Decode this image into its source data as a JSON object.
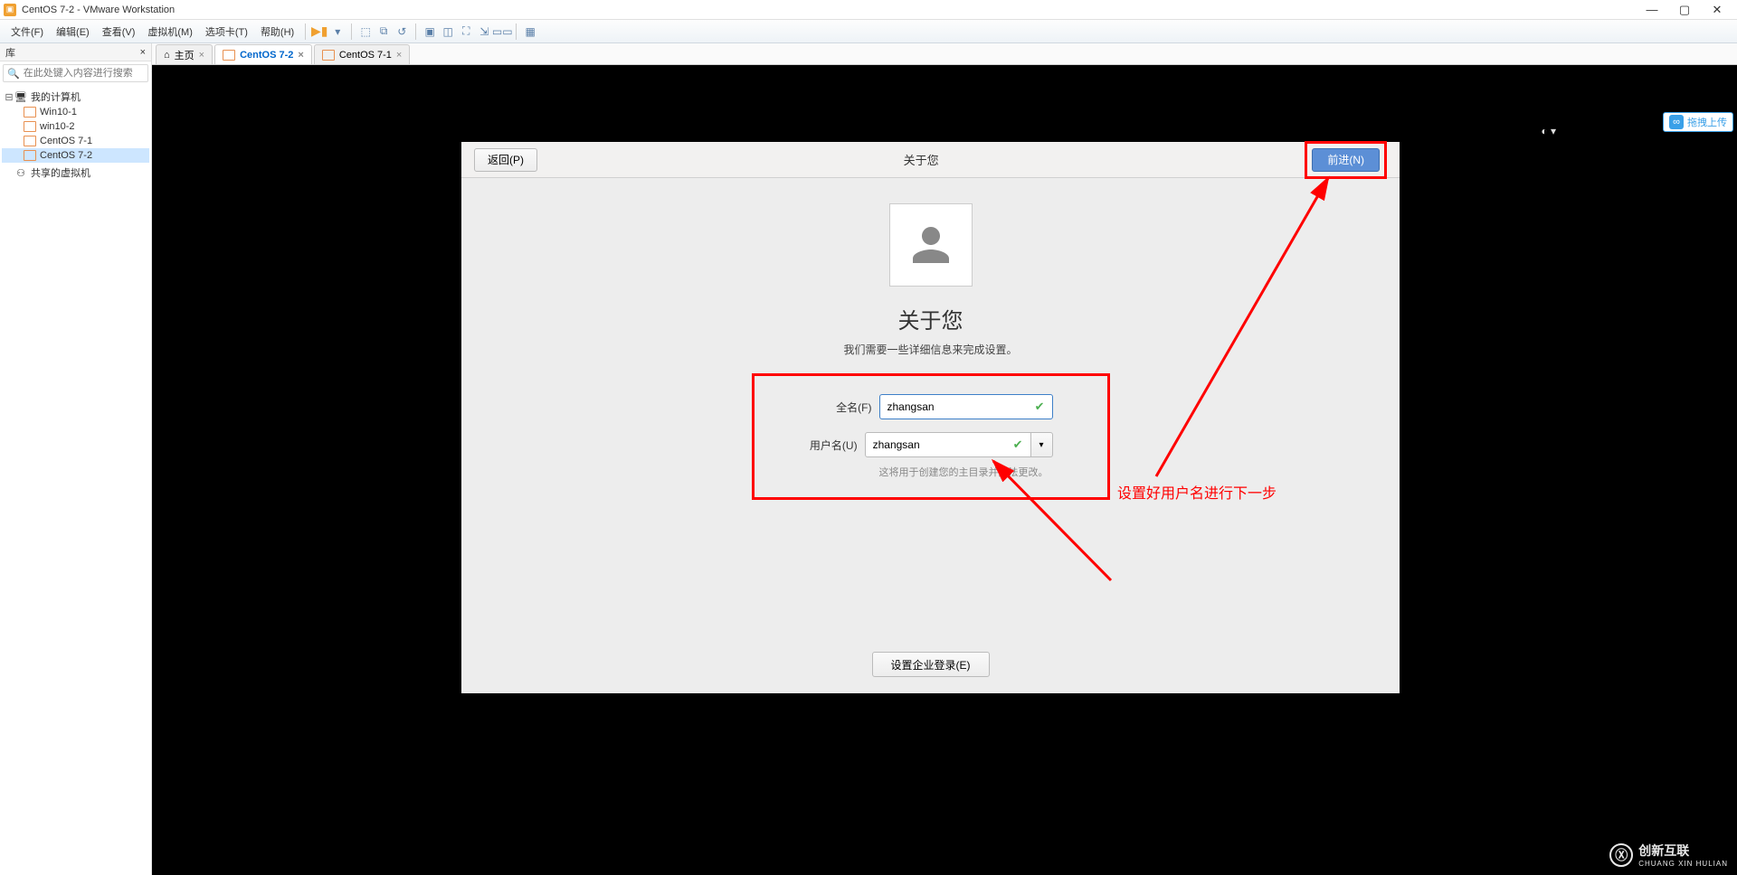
{
  "titlebar": {
    "text": "CentOS 7-2 - VMware Workstation"
  },
  "menu": {
    "file": "文件(F)",
    "edit": "编辑(E)",
    "view": "查看(V)",
    "vm": "虚拟机(M)",
    "tabs": "选项卡(T)",
    "help": "帮助(H)"
  },
  "sidebar": {
    "title": "库",
    "search_placeholder": "在此处键入内容进行搜索",
    "root": "我的计算机",
    "items": [
      {
        "label": "Win10-1"
      },
      {
        "label": "win10-2"
      },
      {
        "label": "CentOS 7-1"
      },
      {
        "label": "CentOS 7-2"
      }
    ],
    "shared": "共享的虚拟机"
  },
  "tabs": [
    {
      "label": "主页",
      "type": "home"
    },
    {
      "label": "CentOS 7-2",
      "type": "vm",
      "active": true
    },
    {
      "label": "CentOS 7-1",
      "type": "vm"
    }
  ],
  "setup": {
    "back": "返回(P)",
    "title": "关于您",
    "next": "前进(N)",
    "heading": "关于您",
    "subtext": "我们需要一些详细信息来完成设置。",
    "fullname_label": "全名(F)",
    "fullname_value": "zhangsan",
    "username_label": "用户名(U)",
    "username_value": "zhangsan",
    "hint": "这将用于创建您的主目录并无法更改。",
    "enterprise": "设置企业登录(E)"
  },
  "annotation": {
    "text": "设置好用户名进行下一步"
  },
  "upload": {
    "label": "拖拽上传"
  },
  "brand": {
    "name": "创新互联"
  }
}
